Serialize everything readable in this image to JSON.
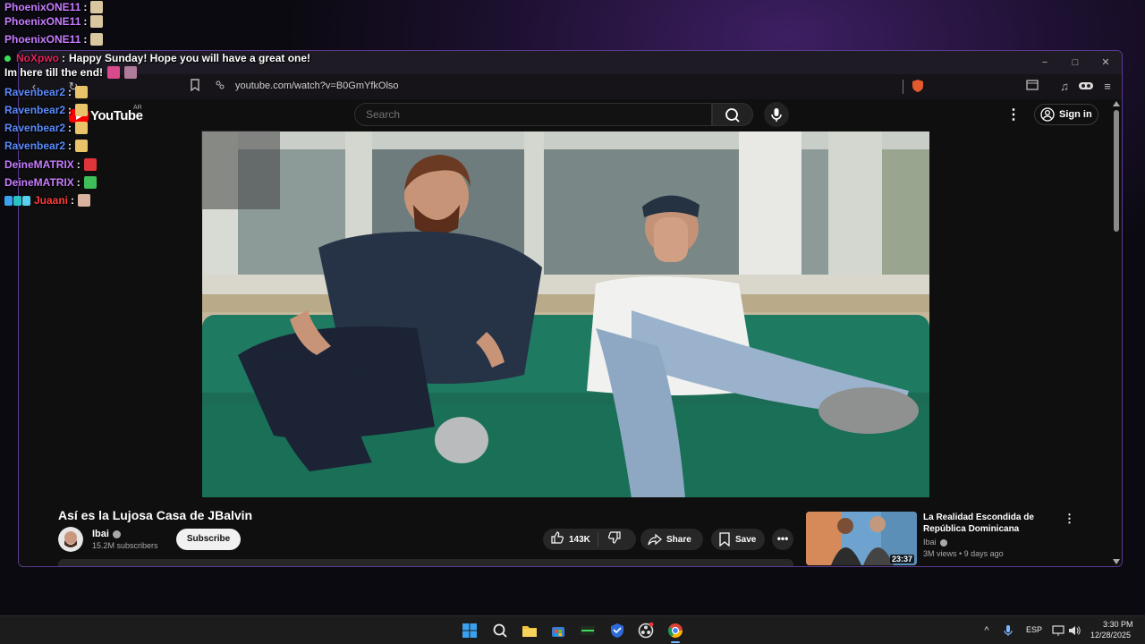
{
  "browser": {
    "url": "youtube.com/watch?v=B0GmYfkOlso",
    "controls": {
      "minimize": "−",
      "maximize": "□",
      "close": "✕"
    }
  },
  "youtube": {
    "logo_text": "YouTube",
    "country_code": "AR",
    "search_placeholder": "Search",
    "sign_in": "Sign in",
    "video": {
      "title": "Así es la Lujosa Casa de JBalvin",
      "channel": "Ibai",
      "subscribers": "15.2M subscribers",
      "subscribe_label": "Subscribe",
      "likes": "143K",
      "share_label": "Share",
      "save_label": "Save"
    },
    "related": {
      "title": "La Realidad Escondida de República Dominicana",
      "channel": "Ibai",
      "meta": "3M views • 9 days ago",
      "duration": "23:37"
    }
  },
  "chat": {
    "messages": [
      {
        "user": "PhoenixONE11",
        "color": "#c77dff",
        "text": "",
        "emote_color": "#d9c7a0"
      },
      {
        "user": "PhoenixONE11",
        "color": "#c77dff",
        "text": "",
        "emote_color": "#d9c7a0"
      },
      {
        "user": "PhoenixONE11",
        "color": "#c77dff",
        "text": "",
        "emote_color": "#d9c7a0"
      },
      {
        "user": "NoXpwo",
        "color": "#e0245e",
        "text": "Happy Sunday! Hope you will have a great one!",
        "emote_color": ""
      },
      {
        "user": "",
        "color": "#ffffff",
        "text": "Im here till the end!",
        "emote_color": "#d94a8c"
      },
      {
        "user": "Ravenbear2",
        "color": "#5b8cff",
        "text": "",
        "emote_color": "#e8c36a"
      },
      {
        "user": "Ravenbear2",
        "color": "#5b8cff",
        "text": "",
        "emote_color": "#e8c36a"
      },
      {
        "user": "Ravenbear2",
        "color": "#5b8cff",
        "text": "",
        "emote_color": "#e8c36a"
      },
      {
        "user": "Ravenbear2",
        "color": "#5b8cff",
        "text": "",
        "emote_color": "#e8c36a"
      },
      {
        "user": "DeineMATRIX",
        "color": "#c77dff",
        "text": "",
        "emote_color": "#e0343b"
      },
      {
        "user": "DeineMATRIX",
        "color": "#c77dff",
        "text": "",
        "emote_color": "#3fbf5a"
      },
      {
        "user": "Juaani",
        "color": "#ff3b3b",
        "text": "",
        "emote_color": "#d9b3a0"
      }
    ]
  },
  "taskbar": {
    "language": "ESP",
    "time": "3:30 PM",
    "date": "12/28/2025"
  }
}
